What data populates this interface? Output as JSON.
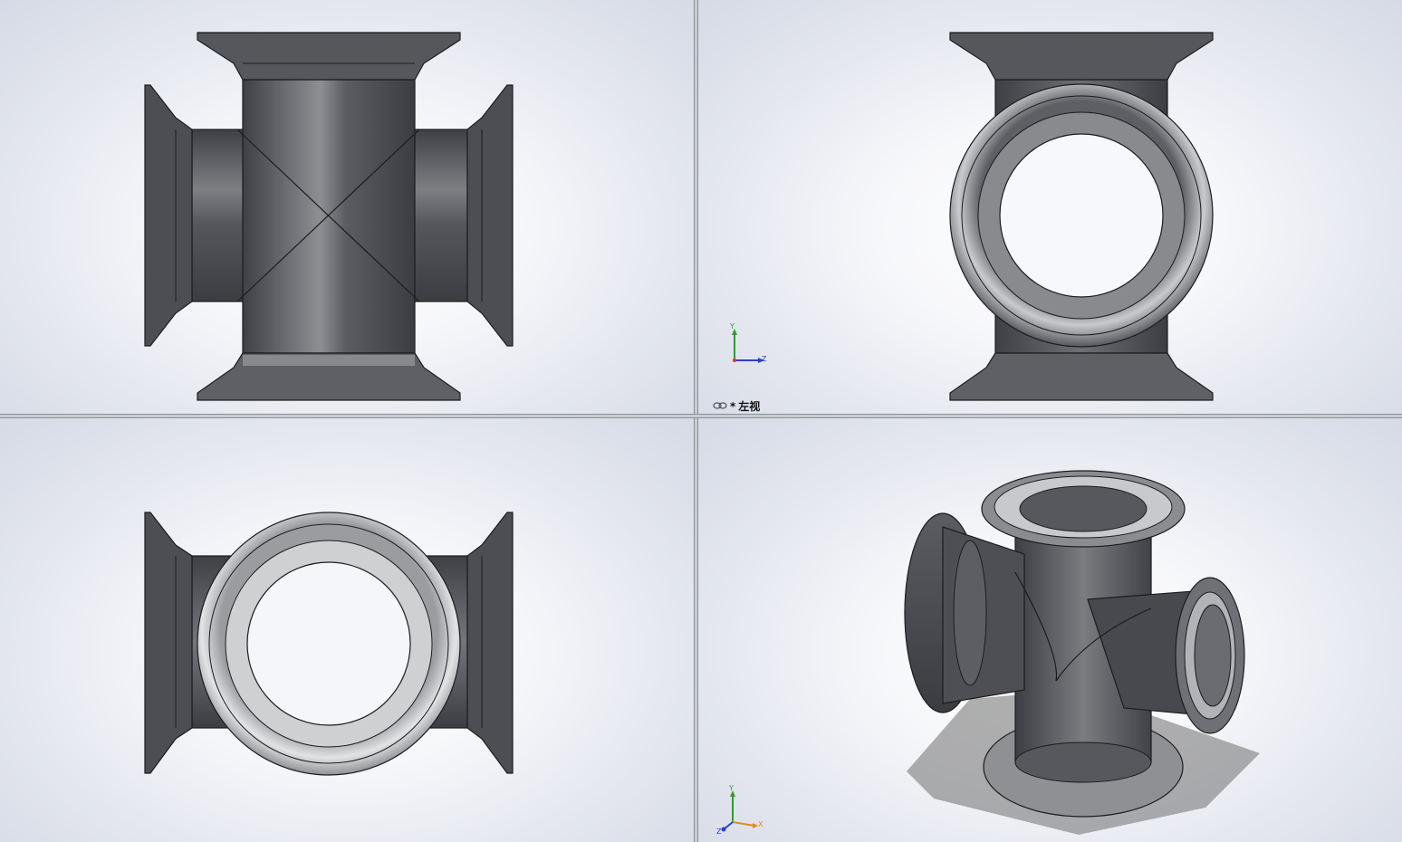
{
  "viewports": {
    "top_left": {
      "name": "front"
    },
    "top_right": {
      "name": "left",
      "label_prefix": "*",
      "label": "左视"
    },
    "bottom_left": {
      "name": "top"
    },
    "bottom_right": {
      "name": "isometric"
    }
  },
  "triad_tr": {
    "y": "Y",
    "z": "Z",
    "x": "X"
  },
  "triad_br": {
    "y": "Y",
    "z": "Z",
    "x": "X"
  },
  "icons": [
    "link-icon",
    "triad-icon"
  ],
  "colors": {
    "metal_dark": "#4f5156",
    "metal_mid": "#6b6d72",
    "metal_light": "#a7a9ad",
    "edge": "#1c1c1e",
    "axis_y": "#2e9d2e",
    "axis_z": "#2b3fd1",
    "axis_x": "#e08a1e"
  }
}
